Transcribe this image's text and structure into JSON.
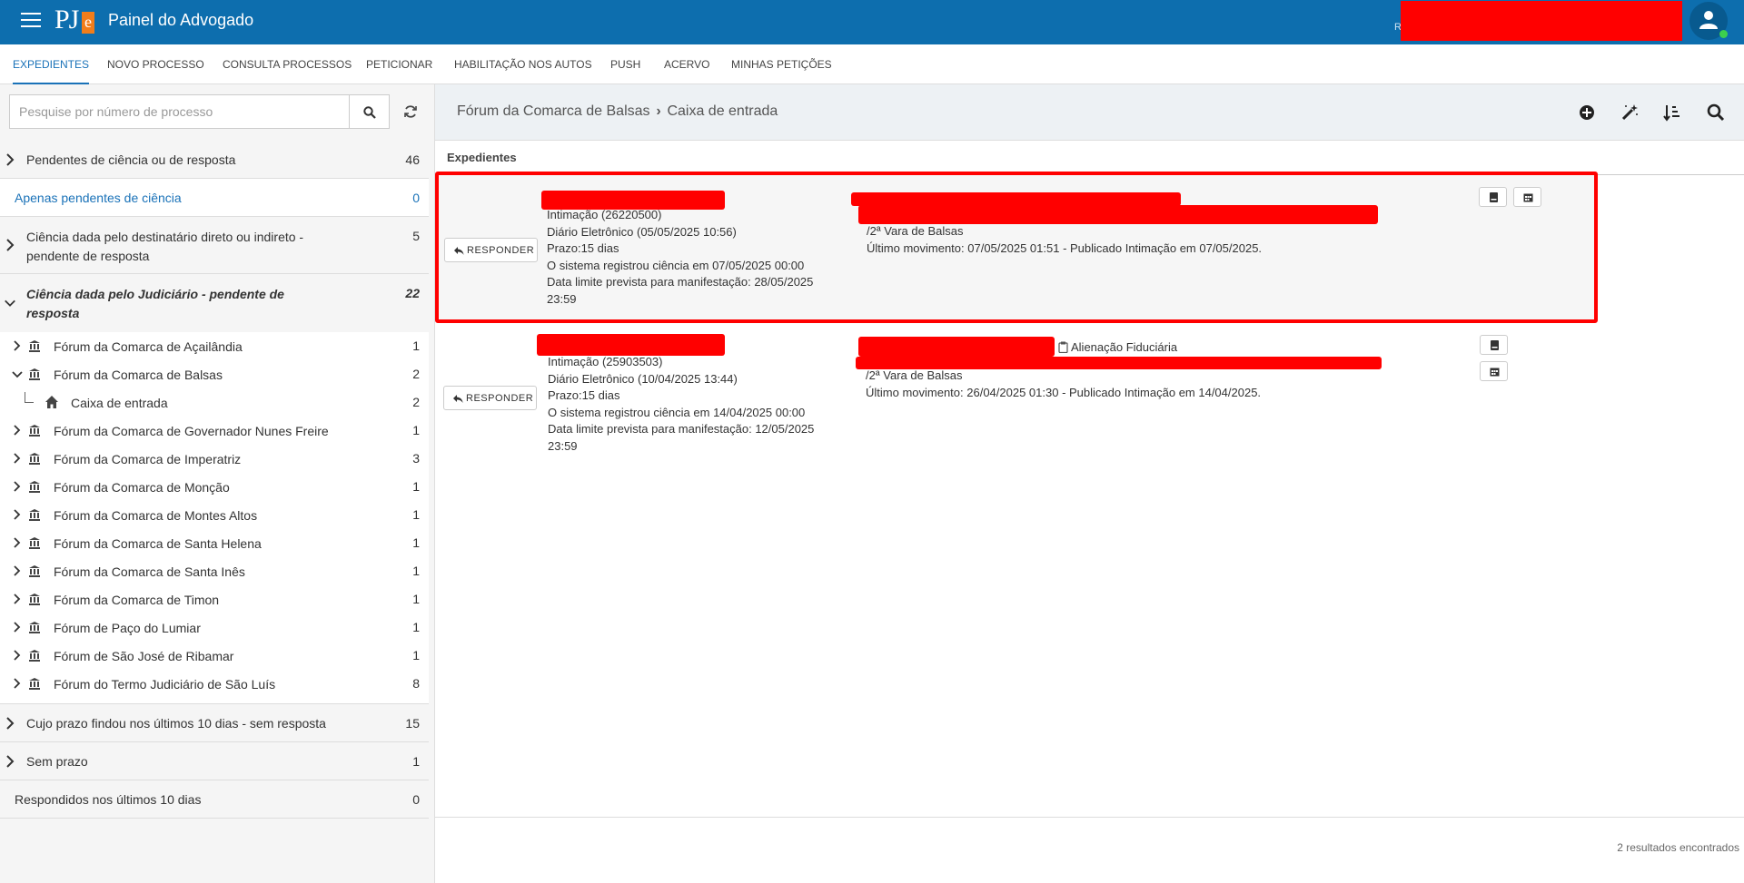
{
  "header": {
    "app_title": "Painel do Advogado",
    "logo_text": "PJ",
    "logo_accent": "e",
    "user_initial": "R",
    "brand_color": "#0d6eae"
  },
  "nav": {
    "tabs": [
      {
        "label": "EXPEDIENTES",
        "active": true
      },
      {
        "label": "NOVO PROCESSO"
      },
      {
        "label": "CONSULTA PROCESSOS"
      },
      {
        "label": "PETICIONAR"
      },
      {
        "label": "HABILITAÇÃO NOS AUTOS"
      },
      {
        "label": "PUSH"
      },
      {
        "label": "ACERVO"
      },
      {
        "label": "MINHAS PETIÇÕES"
      }
    ]
  },
  "sidebar": {
    "search_placeholder": "Pesquise por número de processo",
    "groups": [
      {
        "label": "Pendentes de ciência ou de resposta",
        "count": "46"
      },
      {
        "label": "Apenas pendentes de ciência",
        "count": "0"
      },
      {
        "label_line1": "Ciência dada pelo destinatário direto ou indireto -",
        "label_line2": "pendente de resposta",
        "count": "5"
      },
      {
        "label_line1": "Ciência dada pelo Judiciário - pendente de",
        "label_line2": "resposta",
        "count": "22"
      },
      {
        "label": "Cujo prazo findou nos últimos 10 dias - sem resposta",
        "count": "15"
      },
      {
        "label": "Sem prazo",
        "count": "1"
      },
      {
        "label": "Respondidos nos últimos 10 dias",
        "count": "0"
      }
    ],
    "forums": [
      {
        "label": "Fórum da Comarca de Açailândia",
        "count": "1"
      },
      {
        "label": "Fórum da Comarca de Balsas",
        "count": "2"
      },
      {
        "label": "Caixa de entrada",
        "count": "2"
      },
      {
        "label": "Fórum da Comarca de Governador Nunes Freire",
        "count": "1"
      },
      {
        "label": "Fórum da Comarca de Imperatriz",
        "count": "3"
      },
      {
        "label": "Fórum da Comarca de Monção",
        "count": "1"
      },
      {
        "label": "Fórum da Comarca de Montes Altos",
        "count": "1"
      },
      {
        "label": "Fórum da Comarca de Santa Helena",
        "count": "1"
      },
      {
        "label": "Fórum da Comarca de Santa Inês",
        "count": "1"
      },
      {
        "label": "Fórum da Comarca de Timon",
        "count": "1"
      },
      {
        "label": "Fórum de Paço do Lumiar",
        "count": "1"
      },
      {
        "label": "Fórum de São José de Ribamar",
        "count": "1"
      },
      {
        "label": "Fórum do Termo Judiciário de São Luís",
        "count": "8"
      }
    ]
  },
  "main": {
    "breadcrumb": {
      "forum": "Fórum da Comarca de Balsas",
      "box": "Caixa de entrada"
    },
    "section_title": "Expedientes",
    "reply_label": "RESPONDER",
    "cards": [
      {
        "type": "Intimação (26220500)",
        "channel": "Diário Eletrônico (05/05/2025 10:56)",
        "deadline": "Prazo:15 dias",
        "ack": "O sistema registrou ciência em 07/05/2025 00:00",
        "limit_line1": "Data limite prevista para manifestação: 28/05/2025",
        "limit_line2": "23:59",
        "court": "/2ª Vara de Balsas",
        "last_move": "Último movimento: 07/05/2025 01:51 - Publicado Intimação em 07/05/2025."
      },
      {
        "type": "Intimação (25903503)",
        "channel": "Diário Eletrônico (10/04/2025 13:44)",
        "deadline": "Prazo:15 dias",
        "ack": "O sistema registrou ciência em 14/04/2025 00:00",
        "limit_line1": "Data limite prevista para manifestação: 12/05/2025",
        "limit_line2": "23:59",
        "subject": "Alienação Fiduciária",
        "court": "/2ª Vara de Balsas",
        "last_move": "Último movimento: 26/04/2025 01:30 - Publicado Intimação em 14/04/2025."
      }
    ],
    "results_text": "2 resultados encontrados"
  }
}
